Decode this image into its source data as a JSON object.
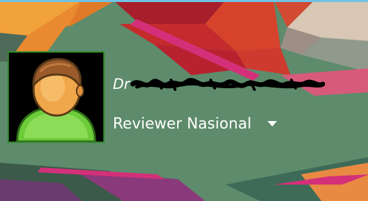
{
  "user": {
    "name_visible_prefix": "Dr",
    "name_obscured": true,
    "role": "Reviewer Nasional"
  },
  "icons": {
    "avatar": "user-avatar-icon",
    "role_dropdown": "triangle-down-icon"
  },
  "colors": {
    "background": "#5b8a6b",
    "text": "#ffffff",
    "avatar_border": "#2f8a2a",
    "top_strip": "#6ec3e6"
  }
}
